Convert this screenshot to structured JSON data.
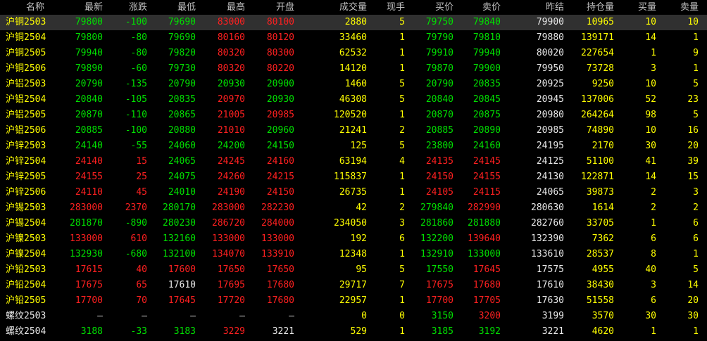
{
  "colors": {
    "up": "#ff2020",
    "down": "#00e000",
    "flat": "#e8e8e8",
    "volume": "#ffff00",
    "header": "#c0c0c0",
    "background": "#000000",
    "selected_row": "#303030"
  },
  "columns": [
    "名称",
    "最新",
    "涨跌",
    "最低",
    "最高",
    "开盘",
    "成交量",
    "现手",
    "买价",
    "卖价",
    "昨结",
    "持仓量",
    "买量",
    "卖量"
  ],
  "selected_row": 0,
  "rows": [
    {
      "name": "沪铜2503",
      "last": "79800",
      "change": "-100",
      "low": "79690",
      "high": "83000",
      "open": "80100",
      "volume": "2880",
      "cur": "5",
      "bid": "79750",
      "ask": "79840",
      "prev": "79900",
      "oi": "10965",
      "bidv": "10",
      "askv": "10",
      "c": {
        "name": "y",
        "last": "g",
        "change": "g",
        "low": "g",
        "high": "r",
        "open": "r",
        "bid": "g",
        "ask": "g"
      }
    },
    {
      "name": "沪铜2504",
      "last": "79800",
      "change": "-80",
      "low": "79690",
      "high": "80160",
      "open": "80120",
      "volume": "33460",
      "cur": "1",
      "bid": "79790",
      "ask": "79810",
      "prev": "79880",
      "oi": "139171",
      "bidv": "14",
      "askv": "1",
      "c": {
        "name": "y",
        "last": "g",
        "change": "g",
        "low": "g",
        "high": "r",
        "open": "r",
        "bid": "g",
        "ask": "g"
      }
    },
    {
      "name": "沪铜2505",
      "last": "79940",
      "change": "-80",
      "low": "79820",
      "high": "80320",
      "open": "80300",
      "volume": "62532",
      "cur": "1",
      "bid": "79910",
      "ask": "79940",
      "prev": "80020",
      "oi": "227654",
      "bidv": "1",
      "askv": "9",
      "c": {
        "name": "y",
        "last": "g",
        "change": "g",
        "low": "g",
        "high": "r",
        "open": "r",
        "bid": "g",
        "ask": "g"
      }
    },
    {
      "name": "沪铜2506",
      "last": "79890",
      "change": "-60",
      "low": "79730",
      "high": "80320",
      "open": "80220",
      "volume": "14120",
      "cur": "1",
      "bid": "79870",
      "ask": "79900",
      "prev": "79950",
      "oi": "73728",
      "bidv": "3",
      "askv": "1",
      "c": {
        "name": "y",
        "last": "g",
        "change": "g",
        "low": "g",
        "high": "r",
        "open": "r",
        "bid": "g",
        "ask": "g"
      }
    },
    {
      "name": "沪铝2503",
      "last": "20790",
      "change": "-135",
      "low": "20790",
      "high": "20930",
      "open": "20900",
      "volume": "1460",
      "cur": "5",
      "bid": "20790",
      "ask": "20835",
      "prev": "20925",
      "oi": "9250",
      "bidv": "10",
      "askv": "5",
      "c": {
        "name": "y",
        "last": "g",
        "change": "g",
        "low": "g",
        "high": "g",
        "open": "g",
        "bid": "g",
        "ask": "g"
      }
    },
    {
      "name": "沪铝2504",
      "last": "20840",
      "change": "-105",
      "low": "20835",
      "high": "20970",
      "open": "20930",
      "volume": "46308",
      "cur": "5",
      "bid": "20840",
      "ask": "20845",
      "prev": "20945",
      "oi": "137006",
      "bidv": "52",
      "askv": "23",
      "c": {
        "name": "y",
        "last": "g",
        "change": "g",
        "low": "g",
        "high": "r",
        "open": "g",
        "bid": "g",
        "ask": "g"
      }
    },
    {
      "name": "沪铝2505",
      "last": "20870",
      "change": "-110",
      "low": "20865",
      "high": "21005",
      "open": "20985",
      "volume": "120520",
      "cur": "1",
      "bid": "20870",
      "ask": "20875",
      "prev": "20980",
      "oi": "264264",
      "bidv": "98",
      "askv": "5",
      "c": {
        "name": "y",
        "last": "g",
        "change": "g",
        "low": "g",
        "high": "r",
        "open": "r",
        "bid": "g",
        "ask": "g"
      }
    },
    {
      "name": "沪铝2506",
      "last": "20885",
      "change": "-100",
      "low": "20880",
      "high": "21010",
      "open": "20960",
      "volume": "21241",
      "cur": "2",
      "bid": "20885",
      "ask": "20890",
      "prev": "20985",
      "oi": "74890",
      "bidv": "10",
      "askv": "16",
      "c": {
        "name": "y",
        "last": "g",
        "change": "g",
        "low": "g",
        "high": "r",
        "open": "g",
        "bid": "g",
        "ask": "g"
      }
    },
    {
      "name": "沪锌2503",
      "last": "24140",
      "change": "-55",
      "low": "24060",
      "high": "24200",
      "open": "24150",
      "volume": "125",
      "cur": "5",
      "bid": "23800",
      "ask": "24160",
      "prev": "24195",
      "oi": "2170",
      "bidv": "30",
      "askv": "20",
      "c": {
        "name": "y",
        "last": "g",
        "change": "g",
        "low": "g",
        "high": "g",
        "open": "g",
        "bid": "g",
        "ask": "g"
      }
    },
    {
      "name": "沪锌2504",
      "last": "24140",
      "change": "15",
      "low": "24065",
      "high": "24245",
      "open": "24160",
      "volume": "63194",
      "cur": "4",
      "bid": "24135",
      "ask": "24145",
      "prev": "24125",
      "oi": "51100",
      "bidv": "41",
      "askv": "39",
      "c": {
        "name": "y",
        "last": "r",
        "change": "r",
        "low": "g",
        "high": "r",
        "open": "r",
        "bid": "r",
        "ask": "r"
      }
    },
    {
      "name": "沪锌2505",
      "last": "24155",
      "change": "25",
      "low": "24075",
      "high": "24260",
      "open": "24215",
      "volume": "115837",
      "cur": "1",
      "bid": "24150",
      "ask": "24155",
      "prev": "24130",
      "oi": "122871",
      "bidv": "14",
      "askv": "15",
      "c": {
        "name": "y",
        "last": "r",
        "change": "r",
        "low": "g",
        "high": "r",
        "open": "r",
        "bid": "r",
        "ask": "r"
      }
    },
    {
      "name": "沪锌2506",
      "last": "24110",
      "change": "45",
      "low": "24010",
      "high": "24190",
      "open": "24150",
      "volume": "26735",
      "cur": "1",
      "bid": "24105",
      "ask": "24115",
      "prev": "24065",
      "oi": "39873",
      "bidv": "2",
      "askv": "3",
      "c": {
        "name": "y",
        "last": "r",
        "change": "r",
        "low": "g",
        "high": "r",
        "open": "r",
        "bid": "r",
        "ask": "r"
      }
    },
    {
      "name": "沪锡2503",
      "last": "283000",
      "change": "2370",
      "low": "280170",
      "high": "283000",
      "open": "282230",
      "volume": "42",
      "cur": "2",
      "bid": "279840",
      "ask": "282990",
      "prev": "280630",
      "oi": "1614",
      "bidv": "2",
      "askv": "2",
      "c": {
        "name": "y",
        "last": "r",
        "change": "r",
        "low": "g",
        "high": "r",
        "open": "r",
        "bid": "g",
        "ask": "r"
      }
    },
    {
      "name": "沪锡2504",
      "last": "281870",
      "change": "-890",
      "low": "280230",
      "high": "286720",
      "open": "284000",
      "volume": "234050",
      "cur": "3",
      "bid": "281860",
      "ask": "281880",
      "prev": "282760",
      "oi": "33705",
      "bidv": "1",
      "askv": "6",
      "c": {
        "name": "y",
        "last": "g",
        "change": "g",
        "low": "g",
        "high": "r",
        "open": "r",
        "bid": "g",
        "ask": "g"
      }
    },
    {
      "name": "沪镍2503",
      "last": "133000",
      "change": "610",
      "low": "132160",
      "high": "133000",
      "open": "133000",
      "volume": "192",
      "cur": "6",
      "bid": "132200",
      "ask": "139640",
      "prev": "132390",
      "oi": "7362",
      "bidv": "6",
      "askv": "6",
      "c": {
        "name": "y",
        "last": "r",
        "change": "r",
        "low": "g",
        "high": "r",
        "open": "r",
        "bid": "g",
        "ask": "r"
      }
    },
    {
      "name": "沪镍2504",
      "last": "132930",
      "change": "-680",
      "low": "132100",
      "high": "134070",
      "open": "133910",
      "volume": "12348",
      "cur": "1",
      "bid": "132910",
      "ask": "133000",
      "prev": "133610",
      "oi": "28537",
      "bidv": "8",
      "askv": "1",
      "c": {
        "name": "y",
        "last": "g",
        "change": "g",
        "low": "g",
        "high": "r",
        "open": "r",
        "bid": "g",
        "ask": "g"
      }
    },
    {
      "name": "沪铅2503",
      "last": "17615",
      "change": "40",
      "low": "17600",
      "high": "17650",
      "open": "17650",
      "volume": "95",
      "cur": "5",
      "bid": "17550",
      "ask": "17645",
      "prev": "17575",
      "oi": "4955",
      "bidv": "40",
      "askv": "5",
      "c": {
        "name": "y",
        "last": "r",
        "change": "r",
        "low": "r",
        "high": "r",
        "open": "r",
        "bid": "g",
        "ask": "r"
      }
    },
    {
      "name": "沪铅2504",
      "last": "17675",
      "change": "65",
      "low": "17610",
      "high": "17695",
      "open": "17680",
      "volume": "29717",
      "cur": "7",
      "bid": "17675",
      "ask": "17680",
      "prev": "17610",
      "oi": "38430",
      "bidv": "3",
      "askv": "14",
      "c": {
        "name": "y",
        "last": "r",
        "change": "r",
        "low": "w",
        "high": "r",
        "open": "r",
        "bid": "r",
        "ask": "r"
      }
    },
    {
      "name": "沪铅2505",
      "last": "17700",
      "change": "70",
      "low": "17645",
      "high": "17720",
      "open": "17680",
      "volume": "22957",
      "cur": "1",
      "bid": "17700",
      "ask": "17705",
      "prev": "17630",
      "oi": "51558",
      "bidv": "6",
      "askv": "20",
      "c": {
        "name": "y",
        "last": "r",
        "change": "r",
        "low": "r",
        "high": "r",
        "open": "r",
        "bid": "r",
        "ask": "r"
      }
    },
    {
      "name": "螺纹2503",
      "last": "—",
      "change": "—",
      "low": "—",
      "high": "—",
      "open": "—",
      "volume": "0",
      "cur": "0",
      "bid": "3150",
      "ask": "3200",
      "prev": "3199",
      "oi": "3570",
      "bidv": "30",
      "askv": "30",
      "c": {
        "name": "w",
        "last": "w",
        "change": "w",
        "low": "w",
        "high": "w",
        "open": "w",
        "bid": "g",
        "ask": "r"
      }
    },
    {
      "name": "螺纹2504",
      "last": "3188",
      "change": "-33",
      "low": "3183",
      "high": "3229",
      "open": "3221",
      "volume": "529",
      "cur": "1",
      "bid": "3185",
      "ask": "3192",
      "prev": "3221",
      "oi": "4620",
      "bidv": "1",
      "askv": "1",
      "c": {
        "name": "w",
        "last": "g",
        "change": "g",
        "low": "g",
        "high": "r",
        "open": "w",
        "bid": "g",
        "ask": "g"
      }
    }
  ]
}
